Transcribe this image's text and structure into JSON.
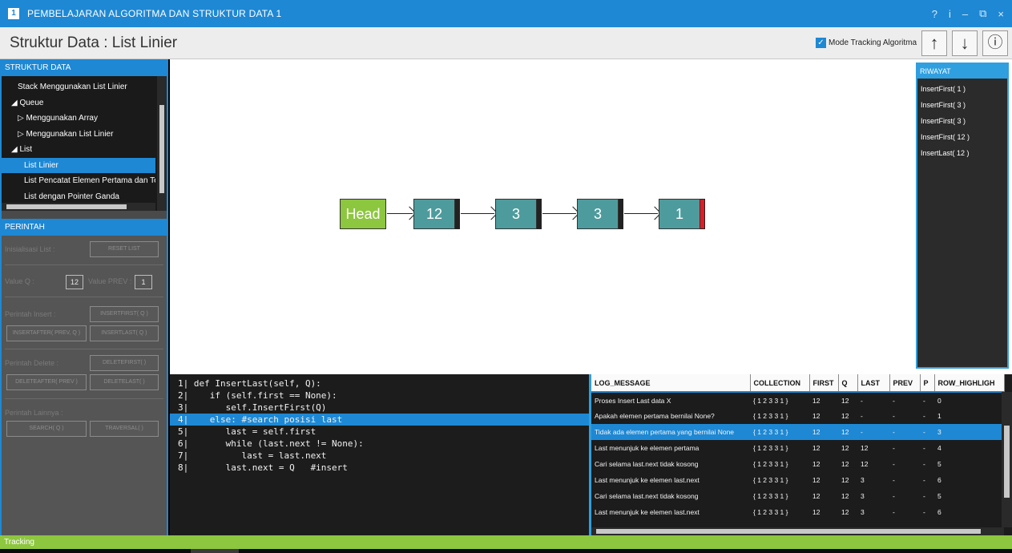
{
  "window": {
    "title": "PEMBELAJARAN ALGORITMA DAN STRUKTUR DATA 1",
    "app_icon": "1",
    "controls": [
      "?",
      "i",
      "–",
      "⧉",
      "×"
    ]
  },
  "header": {
    "title": "Struktur Data : List Linier",
    "tracking_label": "Mode Tracking Algoritma",
    "tracking_checked": true,
    "up_icon": "↑",
    "down_icon": "↓",
    "info_icon": "ⓘ"
  },
  "left": {
    "struktur_title": "STRUKTUR DATA",
    "tree": [
      {
        "label": "Stack Menggunakan List Linier",
        "indent": 2,
        "selected": false
      },
      {
        "label": "◢ Queue",
        "indent": 1,
        "selected": false
      },
      {
        "label": "▷ Menggunakan Array",
        "indent": 2,
        "selected": false
      },
      {
        "label": "▷ Menggunakan List Linier",
        "indent": 2,
        "selected": false
      },
      {
        "label": "◢ List",
        "indent": 1,
        "selected": false
      },
      {
        "label": "List Linier",
        "indent": 3,
        "selected": true
      },
      {
        "label": "List Pencatat Elemen Pertama dan Terakhir",
        "indent": 3,
        "selected": false
      },
      {
        "label": "List dengan Pointer Ganda",
        "indent": 3,
        "selected": false
      }
    ],
    "perintah_title": "PERINTAH",
    "commands": {
      "inisialisasi_label": "Inisialisasi List :",
      "reset": "RESET LIST",
      "value_q_label": "Value Q :",
      "value_q": "12",
      "value_prev_label": "Value PREV :",
      "value_prev": "1",
      "insert_label": "Perintah Insert :",
      "insert_first": "INSERTFIRST( Q )",
      "insert_after": "INSERTAFTER( PREV, Q )",
      "insert_last": "INSERTLAST( Q )",
      "delete_label": "Perintah Delete :",
      "delete_first": "DELETEFIRST( )",
      "delete_after": "DELETEAFTER( PREV )",
      "delete_last": "DELETELAST( )",
      "lainnya_label": "Perintah Lainnya :",
      "search": "SEARCH( Q )",
      "traversal": "TRAVERSAL( )"
    }
  },
  "diagram": {
    "head_label": "Head",
    "nodes": [
      "12",
      "3",
      "3",
      "1"
    ],
    "colors": {
      "head": "#8dc63f",
      "node": "#4e9b9d",
      "null_ptr": "#e01b24"
    }
  },
  "history": {
    "title": "RIWAYAT",
    "items": [
      "InsertFirst( 1 )",
      "InsertFirst( 3 )",
      "InsertFirst( 3 )",
      "InsertFirst( 12 )",
      "InsertLast( 12 )"
    ]
  },
  "code": {
    "highlight_index": 3,
    "lines": [
      "1| def InsertLast(self, Q):",
      "2|    if (self.first == None):",
      "3|       self.InsertFirst(Q)",
      "4|    else: #search posisi last",
      "5|       last = self.first",
      "6|       while (last.next != None):",
      "7|          last = last.next",
      "8|       last.next = Q   #insert"
    ]
  },
  "log": {
    "columns": [
      "LOG_MESSAGE",
      "COLLECTION",
      "FIRST",
      "Q",
      "LAST",
      "PREV",
      "P",
      "ROW_HIGHLIGH"
    ],
    "highlight_index": 2,
    "rows": [
      [
        "Proses Insert Last data X",
        "{ 1 2 3 3 1 }",
        "12",
        "12",
        "-",
        "-",
        "-",
        "0"
      ],
      [
        "Apakah elemen pertama bernilai None?",
        "{ 1 2 3 3 1 }",
        "12",
        "12",
        "-",
        "-",
        "-",
        "1"
      ],
      [
        "Tidak ada elemen pertama yang bernilai None",
        "{ 1 2 3 3 1 }",
        "12",
        "12",
        "-",
        "-",
        "-",
        "3"
      ],
      [
        "Last menunjuk ke elemen pertama",
        "{ 1 2 3 3 1 }",
        "12",
        "12",
        "12",
        "-",
        "-",
        "4"
      ],
      [
        "Cari selama last.next tidak kosong",
        "{ 1 2 3 3 1 }",
        "12",
        "12",
        "12",
        "-",
        "-",
        "5"
      ],
      [
        "Last menunjuk ke elemen last.next",
        "{ 1 2 3 3 1 }",
        "12",
        "12",
        "3",
        "-",
        "-",
        "6"
      ],
      [
        "Cari selama last.next tidak kosong",
        "{ 1 2 3 3 1 }",
        "12",
        "12",
        "3",
        "-",
        "-",
        "5"
      ],
      [
        "Last menunjuk ke elemen last.next",
        "{ 1 2 3 3 1 }",
        "12",
        "12",
        "3",
        "-",
        "-",
        "6"
      ]
    ]
  },
  "status": {
    "text": "Tracking"
  }
}
